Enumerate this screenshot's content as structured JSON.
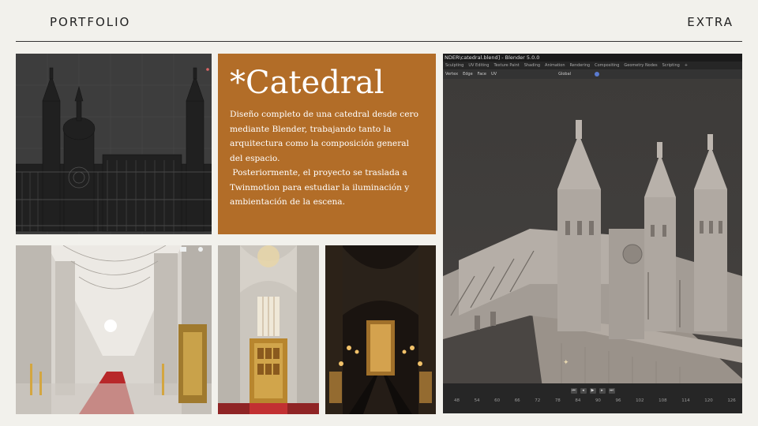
{
  "header": {
    "left": "PORTFOLIO",
    "right": "EXTRA"
  },
  "card": {
    "title": "*Catedral",
    "paragraph1": "Diseño completo de una catedral desde cero mediante Blender, trabajando tanto la arquitectura como la composición general del espacio.",
    "paragraph2": "Posteriormente, el proyecto se traslada a Twinmotion para estudiar la iluminación y ambientación de la escena."
  },
  "blender": {
    "title": "NDER\\catedral.blend] - Blender 5.0.0",
    "tabs": [
      "Sculpting",
      "UV Editing",
      "Texture Paint",
      "Shading",
      "Animation",
      "Rendering",
      "Compositing",
      "Geometry Nodes",
      "Scripting",
      "+"
    ],
    "toolbar": [
      "Vertex",
      "Edge",
      "Face",
      "UV"
    ],
    "orientation": "Global",
    "timeline_ticks": [
      "48",
      "54",
      "60",
      "66",
      "72",
      "78",
      "84",
      "90",
      "96",
      "102",
      "108",
      "114",
      "120",
      "126"
    ]
  },
  "colors": {
    "background": "#f2f1ec",
    "card": "#b26d28",
    "blender_dark": "#2d2d2d"
  }
}
